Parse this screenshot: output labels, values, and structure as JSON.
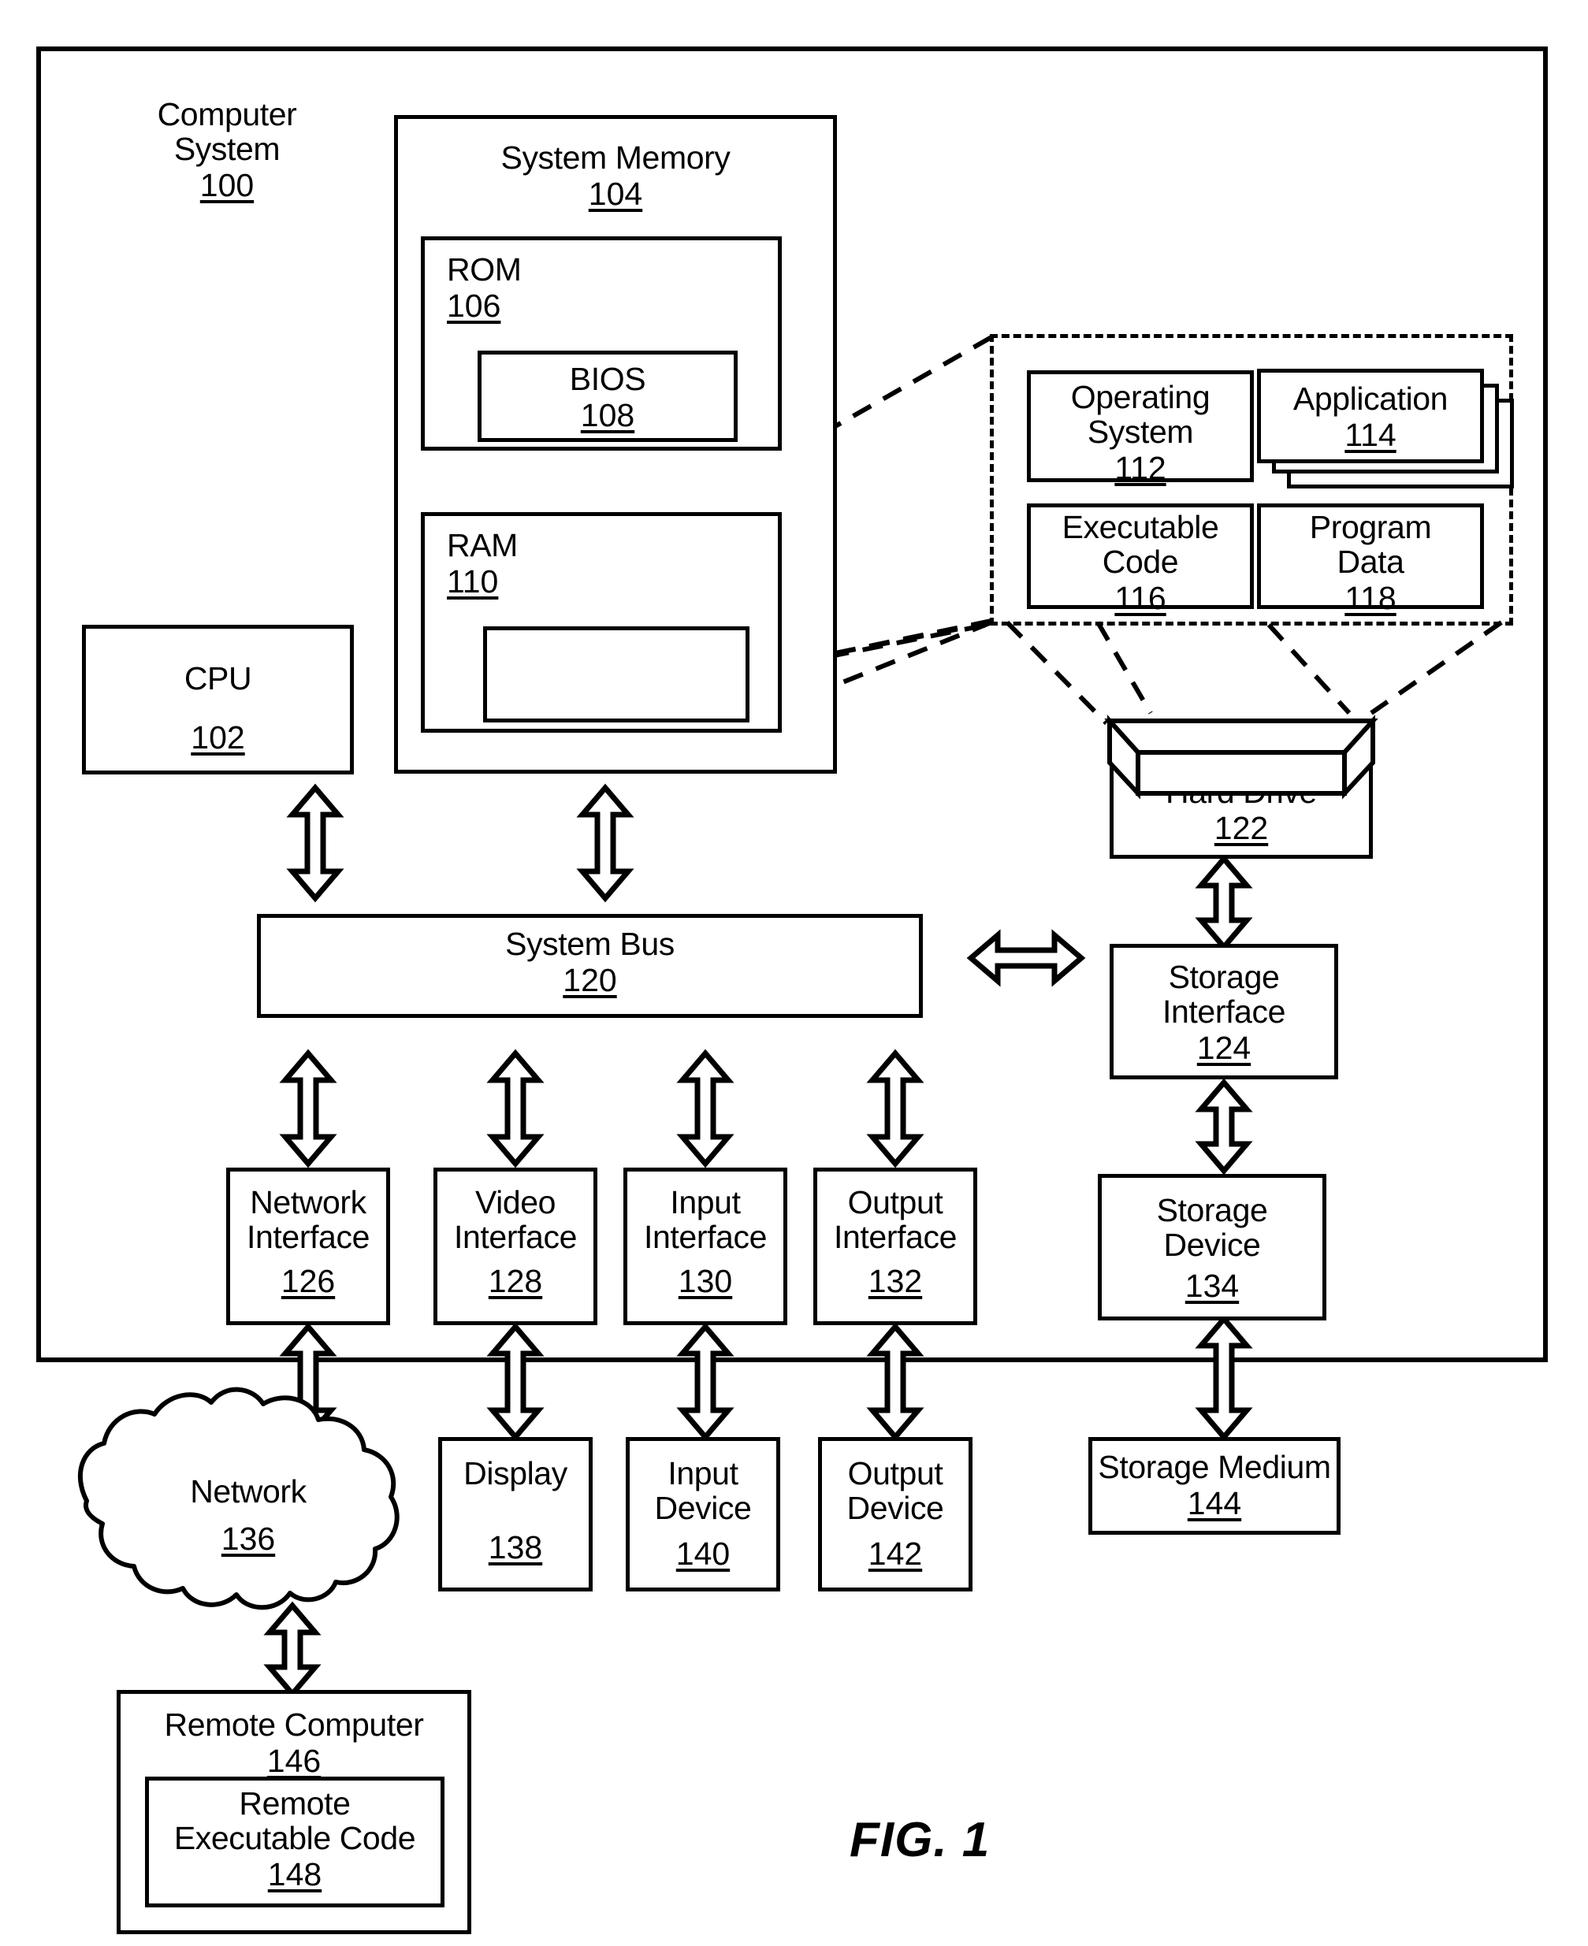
{
  "figure": {
    "label": "FIG. 1",
    "title": "Computer System",
    "title_num": "100"
  },
  "blocks": {
    "computer_system": {
      "label": "Computer System",
      "num": "100"
    },
    "system_memory": {
      "label": "System Memory",
      "num": "104"
    },
    "rom": {
      "label": "ROM",
      "num": "106"
    },
    "bios": {
      "label": "BIOS",
      "num": "108"
    },
    "ram": {
      "label": "RAM",
      "num": "110"
    },
    "cpu": {
      "label": "CPU",
      "num": "102"
    },
    "operating_system": {
      "label": "Operating\nSystem",
      "num": "112"
    },
    "application": {
      "label": "Application",
      "num": "114"
    },
    "executable_code": {
      "label": "Executable\nCode",
      "num": "116"
    },
    "program_data": {
      "label": "Program\nData",
      "num": "118"
    },
    "hard_drive": {
      "label": "Hard Drive",
      "num": "122"
    },
    "system_bus": {
      "label": "System Bus",
      "num": "120"
    },
    "storage_interface": {
      "label": "Storage\nInterface",
      "num": "124"
    },
    "network_interface": {
      "label": "Network\nInterface",
      "num": "126"
    },
    "video_interface": {
      "label": "Video\nInterface",
      "num": "128"
    },
    "input_interface": {
      "label": "Input\nInterface",
      "num": "130"
    },
    "output_interface": {
      "label": "Output\nInterface",
      "num": "132"
    },
    "storage_device": {
      "label": "Storage\nDevice",
      "num": "134"
    },
    "network": {
      "label": "Network",
      "num": "136"
    },
    "display": {
      "label": "Display",
      "num": "138"
    },
    "input_device": {
      "label": "Input\nDevice",
      "num": "140"
    },
    "output_device": {
      "label": "Output\nDevice",
      "num": "142"
    },
    "storage_medium": {
      "label": "Storage Medium",
      "num": "144"
    },
    "remote_computer": {
      "label": "Remote Computer",
      "num": "146"
    },
    "remote_executable_code": {
      "label": "Remote\nExecutable Code",
      "num": "148"
    }
  },
  "colors": {
    "line": "#000000",
    "background": "#ffffff"
  }
}
